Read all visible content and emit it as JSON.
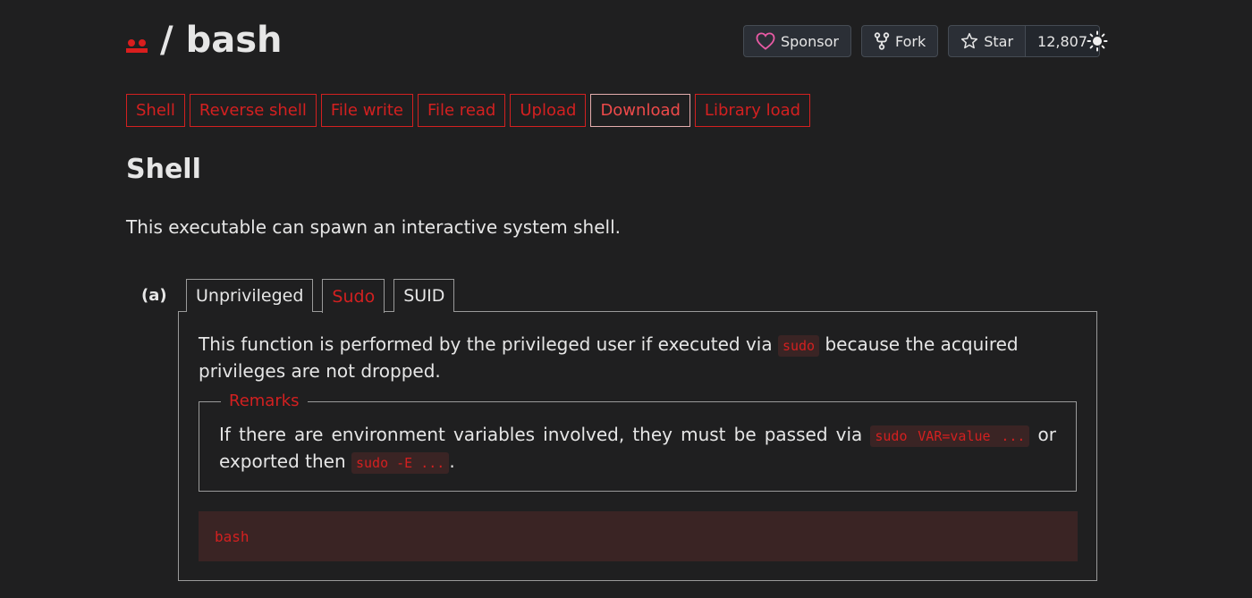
{
  "header": {
    "breadcrumb_sep": "/",
    "title": "bash",
    "sponsor_label": "Sponsor",
    "fork_label": "Fork",
    "star_label": "Star",
    "star_count": "12,807"
  },
  "tags": [
    {
      "label": "Shell"
    },
    {
      "label": "Reverse shell"
    },
    {
      "label": "File write"
    },
    {
      "label": "File read"
    },
    {
      "label": "Upload"
    },
    {
      "label": "Download"
    },
    {
      "label": "Library load"
    }
  ],
  "section": {
    "title": "Shell",
    "description": "This executable can spawn an interactive system shell."
  },
  "example": {
    "label": "(a)",
    "tabs": [
      {
        "label": "Unprivileged"
      },
      {
        "label": "Sudo"
      },
      {
        "label": "SUID"
      }
    ],
    "text_before": "This function is performed by the privileged user if executed via ",
    "text_code": "sudo",
    "text_after": " because the acquired privileges are not dropped.",
    "remarks": {
      "legend": "Remarks",
      "text_1": "If there are environment variables involved, they must be passed via ",
      "code_1": "sudo VAR=value ...",
      "text_2": " or exported then ",
      "code_2": "sudo -E ...",
      "text_3": "."
    },
    "command": "bash"
  },
  "colors": {
    "accent": "#d32020",
    "background": "#1f1f20",
    "code_background": "#3a2424"
  },
  "icons": {
    "sponsor": "heart-icon",
    "fork": "fork-icon",
    "star": "star-icon",
    "theme": "sun-icon"
  }
}
